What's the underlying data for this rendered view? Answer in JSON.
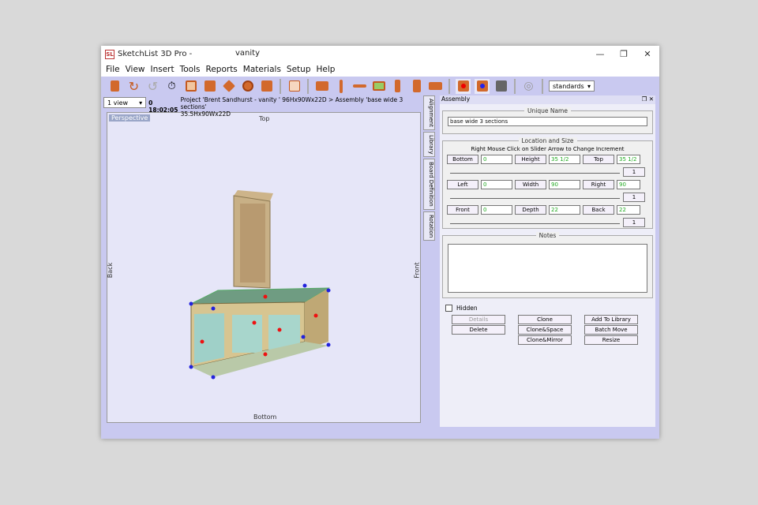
{
  "window": {
    "app_title": "SketchList 3D Pro -",
    "doc_title": "vanity",
    "logo": "SL",
    "controls": [
      "—",
      "❐",
      "✕"
    ]
  },
  "menu": [
    "File",
    "View",
    "Insert",
    "Tools",
    "Reports",
    "Materials",
    "Setup",
    "Help"
  ],
  "toolbar": {
    "standards": "standards"
  },
  "status": {
    "view": "1 view",
    "time": "0 18:02:05",
    "path": "Project 'Brent Sandhurst - vanity ' 96Hx90Wx22D > Assembly 'base wide 3 sections'",
    "size": "35.5Hx90Wx22D"
  },
  "viewport": {
    "mode": "Perspective",
    "top": "Top",
    "bottom": "Bottom",
    "back": "Back",
    "front": "Front"
  },
  "side_tabs": [
    "Alignment",
    "Library",
    "Board Definition",
    "Rotation"
  ],
  "panel": {
    "title": "Assembly",
    "unique_name_title": "Unique Name",
    "unique_name": "base wide 3 sections",
    "loc_title": "Location and Size",
    "hint": "Right Mouse Click on Slider Arrow to Change Increment",
    "rows": [
      [
        {
          "label": "Bottom",
          "value": "0"
        },
        {
          "label": "Height",
          "value": "35 1/2"
        },
        {
          "label": "Top",
          "value": "35 1/2"
        }
      ],
      [
        {
          "label": "Left",
          "value": "0"
        },
        {
          "label": "Width",
          "value": "90"
        },
        {
          "label": "Right",
          "value": "90"
        }
      ],
      [
        {
          "label": "Front",
          "value": "0"
        },
        {
          "label": "Depth",
          "value": "22"
        },
        {
          "label": "Back",
          "value": "22"
        }
      ]
    ],
    "increment": "1",
    "notes_title": "Notes",
    "hidden": "Hidden",
    "buttons": [
      "Details",
      "Clone",
      "Add To Library",
      "Delete",
      "Clone&Space",
      "Batch Move",
      "",
      "Clone&Mirror",
      "Resize"
    ]
  }
}
